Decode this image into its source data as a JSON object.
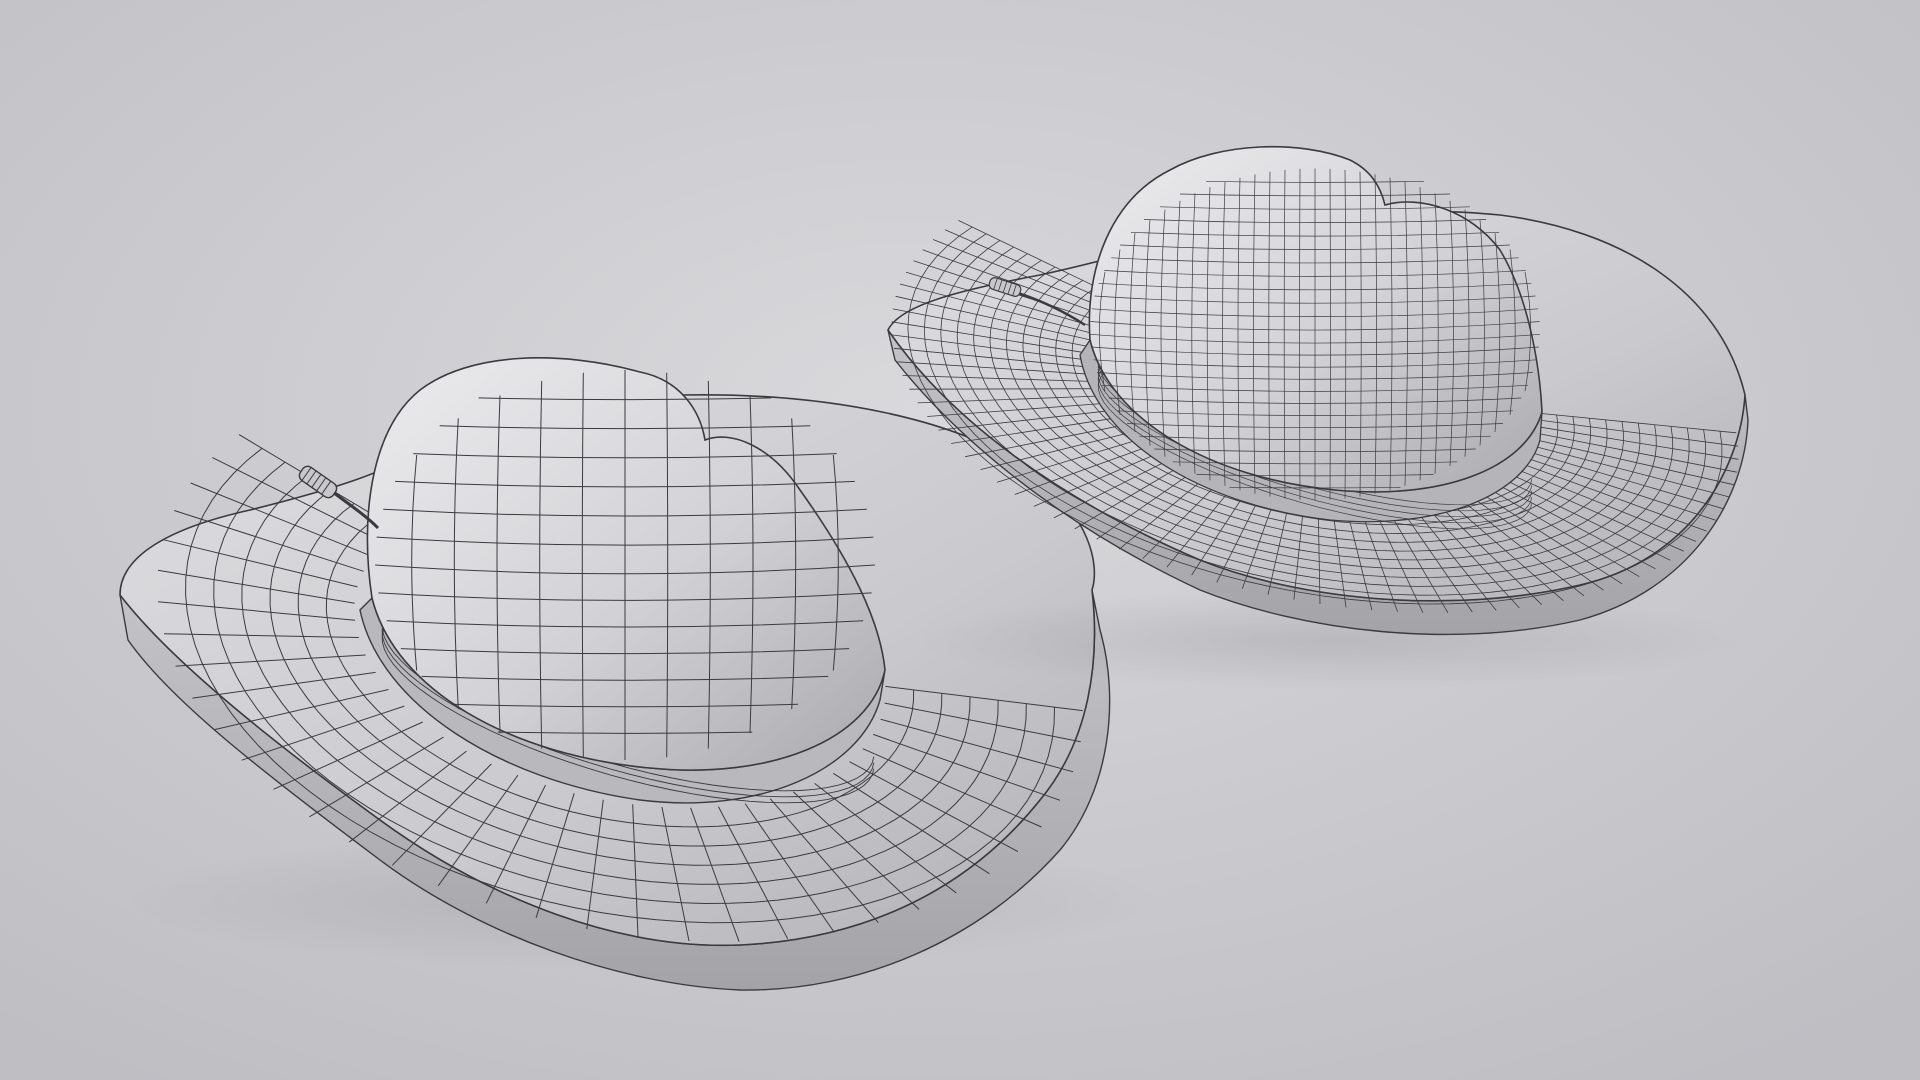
{
  "scene": {
    "background_light": "#d6d6d9",
    "background_dark": "#bdbdc2",
    "shell_light": "#e6e6e8",
    "shell_mid": "#c9c9cd",
    "shell_dark": "#9e9ea4",
    "wire_color": "#3a3a40"
  },
  "models": [
    {
      "name": "hat-wireframe-low-poly",
      "mesh_density": "low"
    },
    {
      "name": "hat-wireframe-high-poly",
      "mesh_density": "high"
    }
  ]
}
